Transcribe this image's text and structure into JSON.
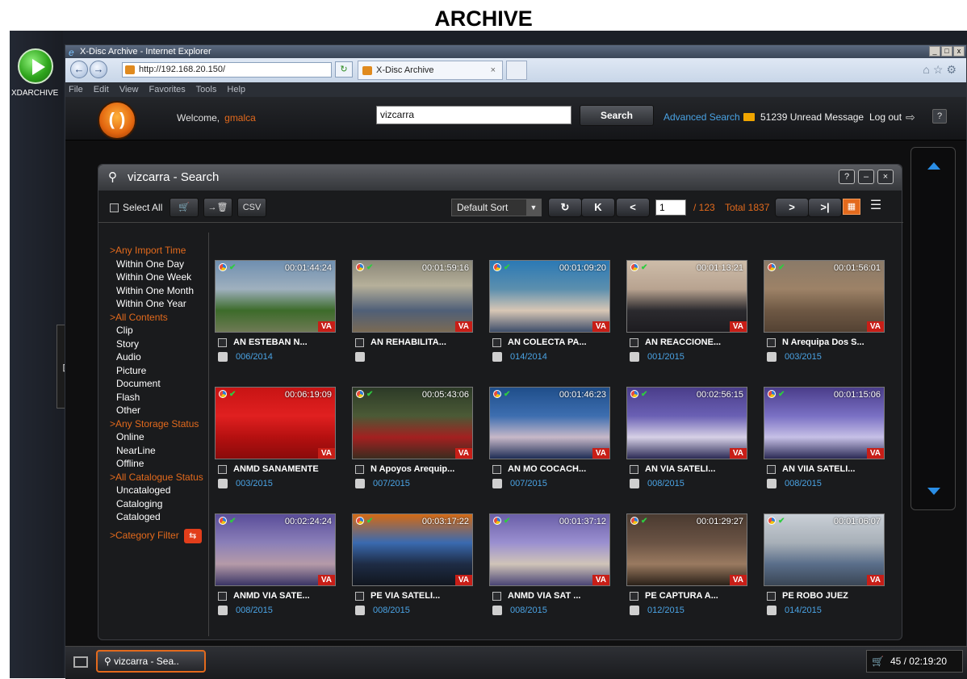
{
  "header": {
    "title": "ARCHIVE"
  },
  "desktop": {
    "icon_label": "XDARCHIVE"
  },
  "ie": {
    "window_title": "X-Disc Archive - Internet Explorer",
    "url": "http://192.168.20.150/",
    "tab_title": "X-Disc Archive",
    "menu": [
      "File",
      "Edit",
      "View",
      "Favorites",
      "Tools",
      "Help"
    ]
  },
  "app": {
    "welcome": "Welcome,",
    "username": "gmalca",
    "search_value": "vizcarra",
    "search_button": "Search",
    "advanced_search": "Advanced Search",
    "unread": "51239  Unread Message",
    "logout": "Log out",
    "help": "?"
  },
  "panel": {
    "title": "vizcarra - Search",
    "select_all": "Select All",
    "sort": "Default Sort",
    "page": "1",
    "page_total": "/ 123",
    "total": "Total  1837"
  },
  "filters": [
    {
      "head": ">Any Import Time",
      "items": [
        "Within One Day",
        "Within One Week",
        "Within One Month",
        "Within One Year"
      ]
    },
    {
      "head": ">All Contents",
      "items": [
        "Clip",
        "Story",
        "Audio",
        "Picture",
        "Document",
        "Flash",
        "Other"
      ]
    },
    {
      "head": ">Any Storage Status",
      "items": [
        "Online",
        "NearLine",
        "Offline"
      ]
    },
    {
      "head": ">All Catalogue Status",
      "items": [
        "Uncataloged",
        "Cataloging",
        "Cataloged"
      ]
    }
  ],
  "category_filter": ">Category Filter",
  "cards": [
    {
      "time": "00:01:44:24",
      "title": "AN ESTEBAN N...",
      "date": "006/2014",
      "bg": "linear-gradient(#6f8fb0 0%, #9fb0be 40%, #3c6b2a 70%, #6f7a55 100%)"
    },
    {
      "time": "00:01:59:16",
      "title": "AN REHABILITA...",
      "date": "",
      "bg": "linear-gradient(#8a8778 0%, #b6b09a 35%, #4f5f78 70%, #7a6a54 100%)"
    },
    {
      "time": "00:01:09:20",
      "title": "AN COLECTA PA...",
      "date": "014/2014",
      "bg": "linear-gradient(#2b79b5 0%, #5c8fae 40%, #d8c7b5 70%, #3e4e6a 100%)"
    },
    {
      "time": "00:01:13:21",
      "title": "AN REACCIONE...",
      "date": "001/2015",
      "bg": "linear-gradient(#cdbca9 0%, #b8a390 40%, #2b2a2e 70%, #1d1c20 100%)"
    },
    {
      "time": "00:01:56:01",
      "title": "N Arequipa Dos S...",
      "date": "003/2015",
      "bg": "linear-gradient(#8a7a68 0%, #9d8267 40%, #6e5844 70%, #544233 100%)"
    },
    {
      "time": "00:06:19:09",
      "title": "ANMD SANAMENTE",
      "date": "003/2015",
      "bg": "linear-gradient(#c81414 0%, #e02020 40%, #b51010 70%, #8a0b0b 100%)"
    },
    {
      "time": "00:05:43:06",
      "title": "N Apoyos Arequip...",
      "date": "007/2015",
      "bg": "linear-gradient(#2c3a27 0%, #4b5a36 40%, #a32020 70%, #3b2c1f 100%)"
    },
    {
      "time": "00:01:46:23",
      "title": "AN MO COCACH...",
      "date": "007/2015",
      "bg": "linear-gradient(#1f4e8a 0%, #3d6eb0 40%, #c7b8c8 70%, #1e2d55 100%)"
    },
    {
      "time": "00:02:56:15",
      "title": "AN VIA SATELI...",
      "date": "008/2015",
      "bg": "linear-gradient(#4a3d8a 0%, #6a60b4 40%, #d6d0e6 70%, #2b2a55 100%)"
    },
    {
      "time": "00:01:15:06",
      "title": "AN VIIA SATELI...",
      "date": "008/2015",
      "bg": "linear-gradient(#4a3d8a 0%, #7a70c4 40%, #c6c0e6 70%, #2b2a55 100%)"
    },
    {
      "time": "00:02:24:24",
      "title": "ANMD VIA SATE...",
      "date": "008/2015",
      "bg": "linear-gradient(#5a4d9a 0%, #8a7fb8 40%, #b59aa8 70%, #3a3565 100%)"
    },
    {
      "time": "00:03:17:22",
      "title": "PE VIA SATELI...",
      "date": "008/2015",
      "bg": "linear-gradient(#d46a14 0%, #3a6ab0 40%, #1e2c45 70%, #11161f 100%)"
    },
    {
      "time": "00:01:37:12",
      "title": "ANMD VIA SAT ...",
      "date": "008/2015",
      "bg": "linear-gradient(#6a5fa8 0%, #9a8fd0 40%, #d0c4b8 70%, #4a4575 100%)"
    },
    {
      "time": "00:01:29:27",
      "title": "PE CAPTURA A...",
      "date": "012/2015",
      "bg": "linear-gradient(#4a3a30 0%, #6a5344 40%, #9a7a60 70%, #2a2018 100%)"
    },
    {
      "time": "00:01:06:07",
      "title": "PE ROBO JUEZ",
      "date": "014/2015",
      "bg": "linear-gradient(#c9cfd6 0%, #a8b0b8 40%, #5a6e8a 70%, #3a4655 100%)"
    }
  ],
  "taskbar": {
    "item": "vizcarra - Sea..",
    "status": "45 / 02:19:20"
  },
  "colors": {
    "accent": "#e36a1d",
    "link": "#4aa3e4",
    "badge": "#c81e17"
  }
}
